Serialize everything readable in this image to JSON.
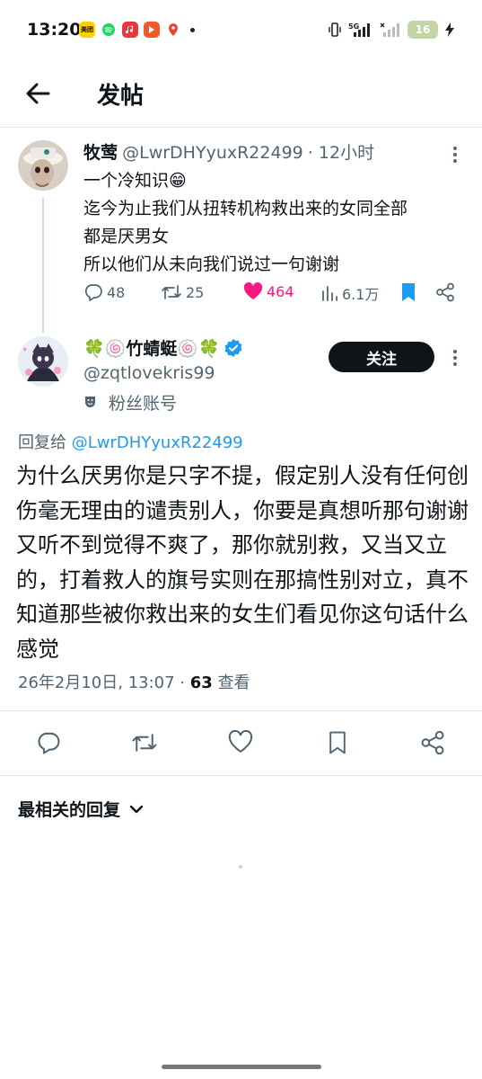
{
  "status_bar": {
    "time": "13:20",
    "app_icons": [
      {
        "name": "meituan-icon",
        "label": "美团",
        "color": "#ffd100"
      },
      {
        "name": "spotify-icon",
        "label": "",
        "color": "#1ed760"
      },
      {
        "name": "music-icon",
        "label": "",
        "color": "#e8383d"
      },
      {
        "name": "app-icon",
        "label": "",
        "color": "#f05a28"
      },
      {
        "name": "maps-icon",
        "label": "",
        "color": "#ffffff"
      }
    ],
    "network": "5G",
    "battery": "16"
  },
  "header": {
    "title": "发帖"
  },
  "original_tweet": {
    "author_name": "牧莺",
    "handle": "@LwrDHYyuxR22499",
    "time_ago": "· 12小时",
    "lines": [
      "一个冷知识😁",
      "迄今为止我们从扭转机构救出来的女同全部",
      "都是厌男女",
      "所以他们从未向我们说过一句谢谢"
    ],
    "replies": "48",
    "retweets": "25",
    "likes": "464",
    "views": "6.1万",
    "colors": {
      "like": "#f91880",
      "bookmark": "#1d9bf0"
    }
  },
  "reply_tweet": {
    "author_name": "🍀🍥竹蜻蜓🍥🍀",
    "handle": "@zqtlovekris99",
    "badge_label": "粉丝账号",
    "follow_label": "关注",
    "reply_prefix": "回复给",
    "reply_mention": "@LwrDHYyuxR22499",
    "text": "为什么厌男你是只字不提，假定别人没有任何创伤毫无理由的谴责别人，你要是真想听那句谢谢又听不到觉得不爽了，那你就别救，又当又立的，打着救人的旗号实则在那搞性别对立，真不知道那些被你救出来的女生们看见你这句话什么感觉",
    "timestamp": "26年2月10日, 13:07 ·",
    "view_count": "63",
    "view_label": "查看",
    "colors": {
      "verified": "#1d9bf0"
    }
  },
  "sort_label": "最相关的回复"
}
